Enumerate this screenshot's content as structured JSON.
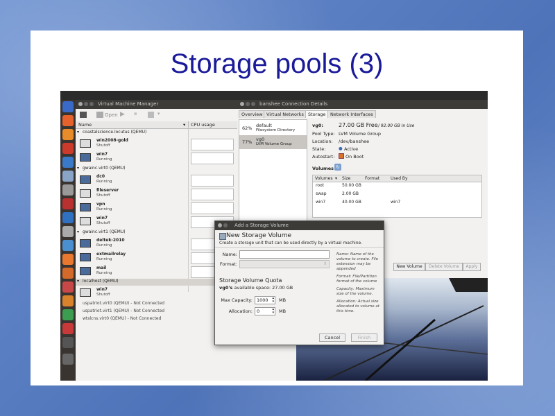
{
  "slide": {
    "title": "Storage pools (3)"
  },
  "vmm": {
    "title": "Virtual Machine Manager",
    "toolbar_open": "Open",
    "col_name": "Name",
    "col_cpu": "CPU usage",
    "groups": [
      {
        "host": "coastalscience.locutus (QEMU)",
        "vms": [
          {
            "name": "win2008-gold",
            "status": "Shutoff"
          },
          {
            "name": "win7",
            "status": "Running"
          }
        ]
      },
      {
        "host": "gwainc.virt0 (QEMU)",
        "vms": [
          {
            "name": "dc0",
            "status": "Running"
          },
          {
            "name": "fileserver",
            "status": "Shutoff"
          },
          {
            "name": "vpn",
            "status": "Running"
          },
          {
            "name": "win7",
            "status": "Shutoff"
          }
        ]
      },
      {
        "host": "gwainc.virt1 (QEMU)",
        "vms": [
          {
            "name": "deltek-2010",
            "status": "Running"
          },
          {
            "name": "extmailrelay",
            "status": "Running"
          },
          {
            "name": "mail",
            "status": "Running"
          }
        ]
      },
      {
        "host": "localhost (QEMU)",
        "vms": [
          {
            "name": "win7",
            "status": "Shutoff"
          }
        ]
      }
    ],
    "disconnected": [
      "uspatriot.virt0 (QEMU) - Not Connected",
      "uspatriot.virt1 (QEMU) - Not Connected",
      "wtslcns.virt0 (QEMU) - Not Connected"
    ]
  },
  "details": {
    "title": "banshee Connection Details",
    "tabs": [
      "Overview",
      "Virtual Networks",
      "Storage",
      "Network Interfaces"
    ],
    "pools": [
      {
        "pct": "62%",
        "name": "default",
        "sub": "Filesystem Directory"
      },
      {
        "pct": "77%",
        "name": "vg0",
        "sub": "LVM Volume Group"
      }
    ],
    "pool_name": "vg0:",
    "free": "27.00 GB Free",
    "inuse": "/ 92.00 GB In Use",
    "labels": {
      "type": "Pool Type:",
      "location": "Location:",
      "state": "State:",
      "autostart": "Autostart:"
    },
    "values": {
      "type": "LVM Volume Group",
      "location": "/dev/banshee",
      "state": "Active",
      "autostart": "On Boot"
    },
    "volumes_label": "Volumes",
    "vol_cols": [
      "Volumes",
      "Size",
      "Format",
      "Used By"
    ],
    "volumes": [
      {
        "name": "root",
        "size": "50.00 GB",
        "format": "",
        "usedby": ""
      },
      {
        "name": "swap",
        "size": "2.00 GB",
        "format": "",
        "usedby": ""
      },
      {
        "name": "win7",
        "size": "40.00 GB",
        "format": "",
        "usedby": "win7"
      }
    ],
    "btn_new": "New Volume",
    "btn_delete": "Delete Volume",
    "btn_apply": "Apply"
  },
  "dialog": {
    "title": "Add a Storage Volume",
    "heading": "New Storage Volume",
    "subheading": "Create a storage unit that can be used directly by a virtual machine.",
    "name_label": "Name:",
    "format_label": "Format:",
    "quota_title": "Storage Volume Quota",
    "avail_pool": "vg0's",
    "avail_text": "available space: 27.00 GB",
    "capacity_label": "Max Capacity:",
    "capacity_value": "1000",
    "capacity_unit": "MB",
    "alloc_label": "Allocation:",
    "alloc_value": "0",
    "alloc_unit": "MB",
    "help_name": "Name: Name of the volume to create. File extension may be appended",
    "help_format": "Format: File/Partition format of the volume",
    "help_capacity": "Capacity: Maximum size of the volume.",
    "help_alloc": "Allocation: Actual size allocated to volume at this time.",
    "cancel": "Cancel",
    "finish": "Finish"
  }
}
